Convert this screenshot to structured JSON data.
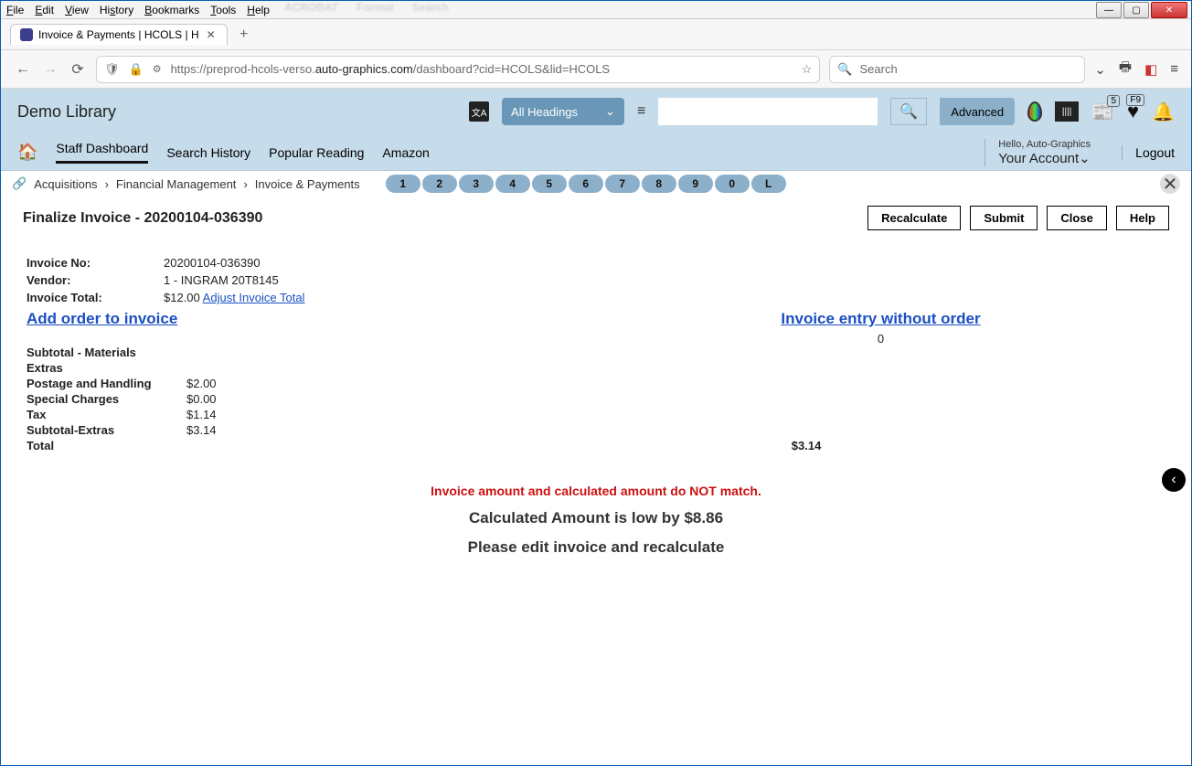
{
  "window": {
    "menubar": [
      "File",
      "Edit",
      "View",
      "History",
      "Bookmarks",
      "Tools",
      "Help"
    ],
    "tab_title": "Invoice & Payments | HCOLS | H",
    "url_display_pre": "https://preprod-hcols-verso.",
    "url_display_bold": "auto-graphics.com",
    "url_display_post": "/dashboard?cid=HCOLS&lid=HCOLS",
    "search_placeholder": "Search"
  },
  "header": {
    "library_name": "Demo Library",
    "headings_label": "All Headings",
    "advanced_label": "Advanced",
    "badge_count": "5",
    "heart_badge": "F9"
  },
  "nav": {
    "items": [
      "Staff Dashboard",
      "Search History",
      "Popular Reading",
      "Amazon"
    ],
    "hello": "Hello, Auto-Graphics",
    "account": "Your Account",
    "logout": "Logout"
  },
  "breadcrumb": {
    "items": [
      "Acquisitions",
      "Financial Management",
      "Invoice & Payments"
    ],
    "pills": [
      "1",
      "2",
      "3",
      "4",
      "5",
      "6",
      "7",
      "8",
      "9",
      "0",
      "L"
    ]
  },
  "page": {
    "title": "Finalize Invoice - 20200104-036390",
    "buttons": {
      "recalculate": "Recalculate",
      "submit": "Submit",
      "close": "Close",
      "help": "Help"
    }
  },
  "invoice": {
    "no_label": "Invoice No:",
    "no_value": "20200104-036390",
    "vendor_label": "Vendor:",
    "vendor_value": "1 - INGRAM 20T8145",
    "total_label": "Invoice Total:",
    "total_value": "$12.00",
    "adjust_link": "Adjust Invoice Total",
    "add_order_link": "Add order to invoice",
    "entry_without_order_link": "Invoice entry without order",
    "entry_without_order_count": "0",
    "subtotal_materials_label": "Subtotal - Materials",
    "extras_label": "Extras",
    "postage_label": "Postage and Handling",
    "postage_value": "$2.00",
    "special_label": "Special Charges",
    "special_value": "$0.00",
    "tax_label": "Tax",
    "tax_value": "$1.14",
    "subtotal_extras_label": "Subtotal-Extras",
    "subtotal_extras_value": "$3.14",
    "grand_total_label": "Total",
    "grand_total_value": "$3.14"
  },
  "messages": {
    "mismatch": "Invoice amount and calculated amount do NOT match.",
    "low_by": "Calculated Amount is low by $8.86",
    "please_edit": "Please edit invoice and recalculate"
  }
}
